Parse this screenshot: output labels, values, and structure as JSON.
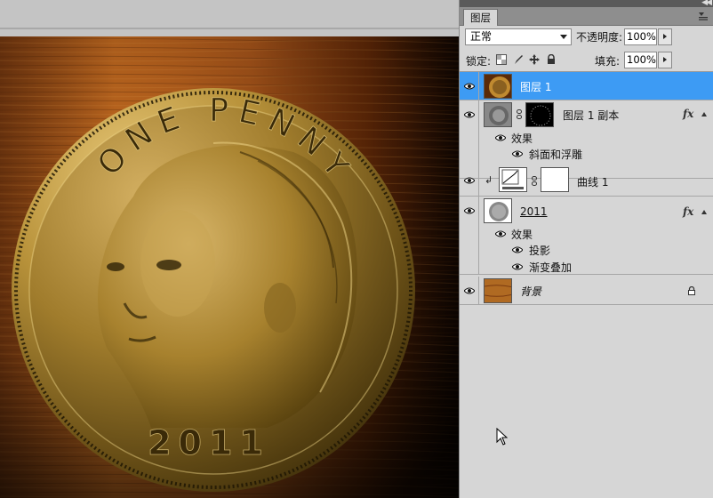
{
  "panel": {
    "tab_label": "图层",
    "blend_mode": "正常",
    "opacity_label": "不透明度:",
    "opacity_value": "100%",
    "lock_label": "锁定:",
    "fill_label": "填充:",
    "fill_value": "100%"
  },
  "layers": [
    {
      "name": "图层 1",
      "selected": true
    },
    {
      "name": "图层 1 副本",
      "fx": "fx",
      "effects_label": "效果",
      "effects": [
        "斜面和浮雕"
      ]
    },
    {
      "name": "曲线 1"
    },
    {
      "name": "2011",
      "fx": "fx",
      "effects_label": "效果",
      "effects": [
        "投影",
        "渐变叠加"
      ]
    },
    {
      "name": "背景"
    }
  ],
  "canvas": {
    "coin_top_text": "ONE PENNY",
    "coin_year": "2011"
  },
  "colors": {
    "selection": "#3d9bf4",
    "coin_gold": "#b8923a",
    "wood": "#a0521c"
  },
  "icons": [
    "eye-icon",
    "chain-icon",
    "fx-icon",
    "lock-icon",
    "collapse-icon",
    "panel-menu-icon",
    "cursor-arrow-icon"
  ]
}
